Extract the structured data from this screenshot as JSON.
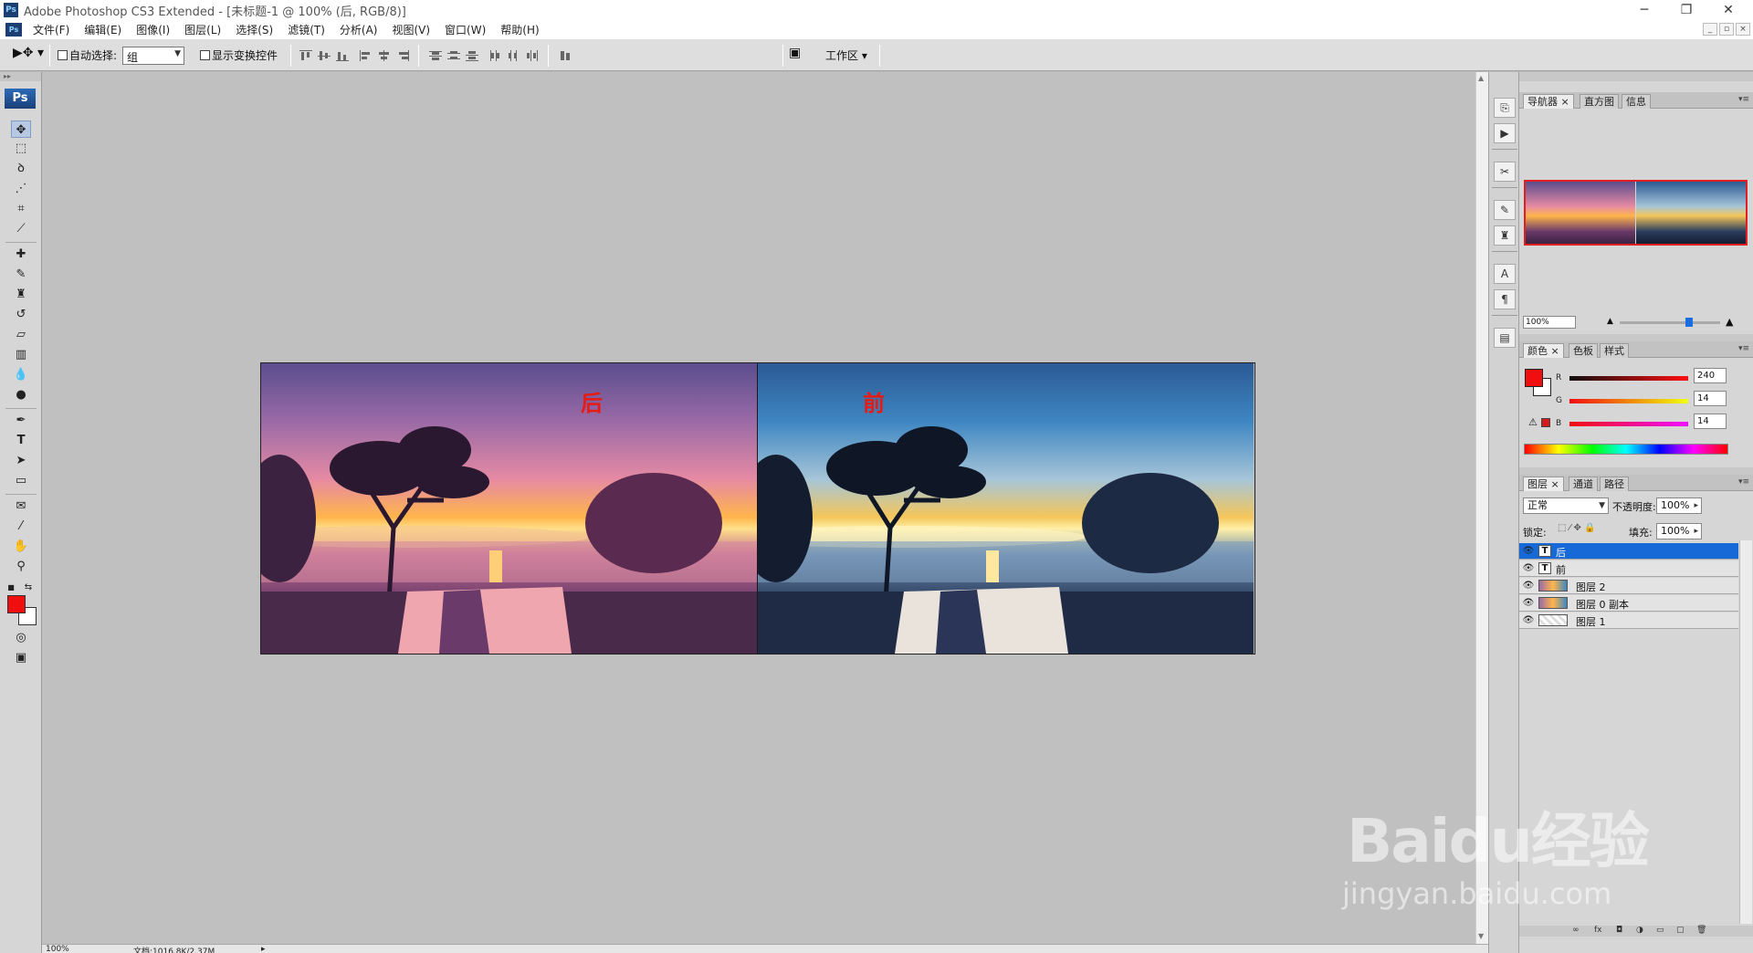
{
  "window": {
    "title": "Adobe Photoshop CS3 Extended - [未标题-1 @ 100% (后, RGB/8)]",
    "app_icon": "ps-icon",
    "controls": {
      "minimize": "─",
      "restore": "❐",
      "close": "✕"
    }
  },
  "menubar": {
    "items": [
      "文件(F)",
      "编辑(E)",
      "图像(I)",
      "图层(L)",
      "选择(S)",
      "滤镜(T)",
      "分析(A)",
      "视图(V)",
      "窗口(W)",
      "帮助(H)"
    ]
  },
  "options": {
    "auto_select_label": "自动选择:",
    "auto_select_value": "组",
    "show_transform_label": "显示变换控件",
    "workspace_label": "工作区"
  },
  "tools": {
    "logo": "Ps",
    "fg_color": "#f00e0e",
    "bg_color": "#ffffff"
  },
  "document": {
    "label_after": "后",
    "label_before": "前"
  },
  "statusbar": {
    "zoom": "100%",
    "doc_info": "文档:1016.8K/2.37M"
  },
  "panels": {
    "navigator": {
      "tabs": [
        "导航器",
        "直方图",
        "信息"
      ],
      "zoom": "100%"
    },
    "color": {
      "tabs": [
        "颜色",
        "色板",
        "样式"
      ],
      "r_label": "R",
      "g_label": "G",
      "b_label": "B",
      "r": "240",
      "g": "14",
      "b": "14"
    },
    "layers": {
      "tabs": [
        "图层",
        "通道",
        "路径"
      ],
      "blend_mode": "正常",
      "opacity_label": "不透明度:",
      "opacity": "100%",
      "lock_label": "锁定:",
      "fill_label": "填充:",
      "fill": "100%",
      "items": [
        {
          "name": "后",
          "type": "text",
          "active": true
        },
        {
          "name": "前",
          "type": "text",
          "active": false
        },
        {
          "name": "图层 2",
          "type": "image",
          "active": false
        },
        {
          "name": "图层 0 副本",
          "type": "image",
          "active": false
        },
        {
          "name": "图层 1",
          "type": "transparent",
          "active": false
        }
      ]
    }
  },
  "watermark": {
    "main": "Baidu经验",
    "sub": "jingyan.baidu.com"
  },
  "colors": {
    "accent": "#1669d6",
    "red_label": "#e81a12"
  }
}
